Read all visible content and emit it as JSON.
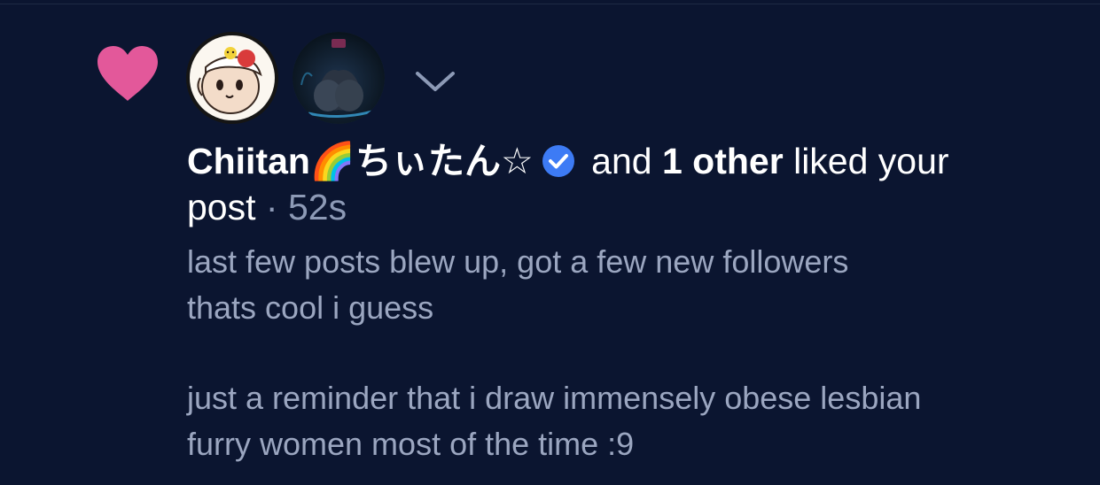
{
  "notification": {
    "user_name": "Chiitan🌈ちぃたん☆",
    "and_text": "and",
    "others_text": "1 other",
    "action_text": "liked your",
    "object_text": "post",
    "separator": "·",
    "time": "52s"
  },
  "post": {
    "line1": "last few posts blew up, got a few new followers",
    "line2": "thats cool i guess",
    "line3": "just a reminder that i draw immensely obese lesbian",
    "line4": "furry women most of the time :9"
  },
  "icons": {
    "like": "heart-icon",
    "verified": "verified-badge-icon",
    "expand": "chevron-down-icon"
  },
  "colors": {
    "background": "#0b1530",
    "heart": "#e3589a",
    "verified": "#3d7bf5",
    "primary_text": "#ffffff",
    "secondary_text": "#9ba6c0"
  }
}
